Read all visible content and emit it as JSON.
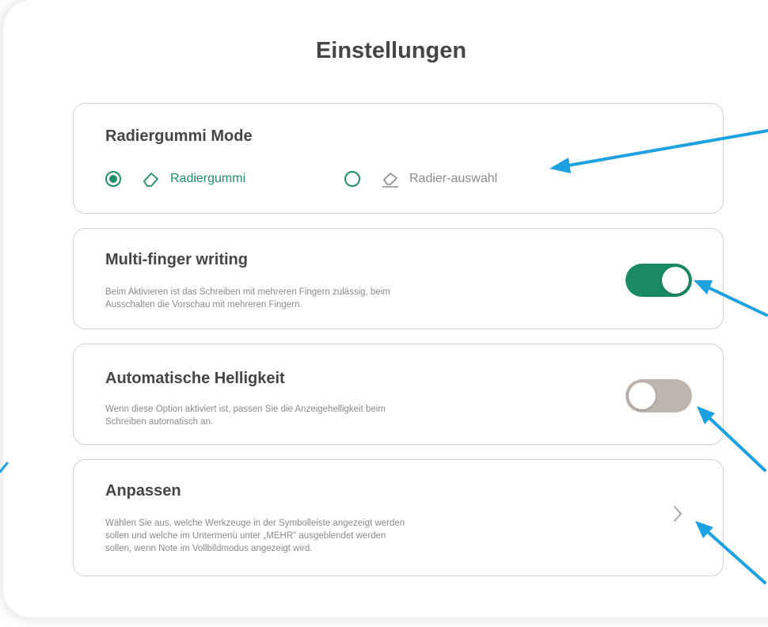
{
  "dialog": {
    "title": "Einstellungen"
  },
  "eraser_mode": {
    "title": "Radiergummi Mode",
    "options": [
      {
        "label": "Radiergummi",
        "icon": "eraser-icon",
        "selected": true
      },
      {
        "label": "Radier-auswahl",
        "icon": "eraser-selection-icon",
        "selected": false
      }
    ]
  },
  "multi_finger": {
    "title": "Multi-finger writing",
    "description_line1": "Beim Aktivieren ist das Schreiben mit mehreren Fingern zulässig, beim",
    "description_line2": "Ausschalten die Vorschau mit mehreren Fingern.",
    "enabled": true
  },
  "auto_brightness": {
    "title": "Automatische Helligkeit",
    "description_line1": "Wenn diese Option aktiviert ist, passen Sie die Anzeigehelligkeit beim",
    "description_line2": "Schreiben automatisch an.",
    "enabled": false
  },
  "customize": {
    "title": "Anpassen",
    "description_line1": "Wählen Sie aus, welche Werkzeuge in der Symbolleiste angezeigt werden",
    "description_line2": "sollen und welche im Untermenü unter „MEHR\" ausgeblendet werden",
    "description_line3": "sollen, wenn Note im Vollbildmodus angezeigt wird.",
    "icon": "chevron-right-icon"
  },
  "colors": {
    "accent": "#1a8a63",
    "toggle_off": "#bfb5af",
    "annotation_arrow": "#1ea1e0"
  }
}
